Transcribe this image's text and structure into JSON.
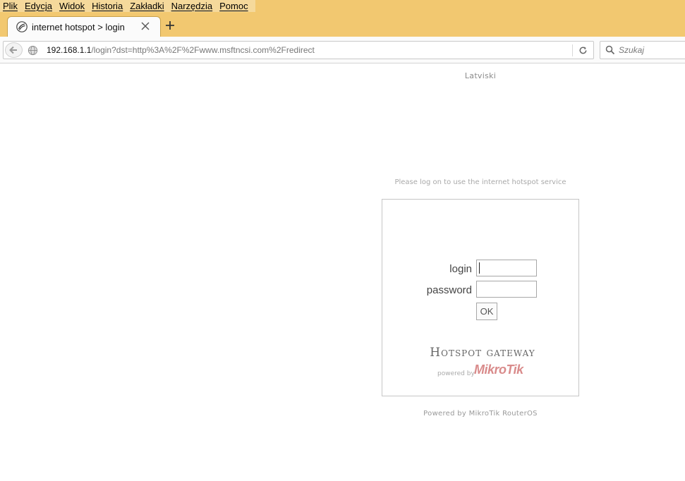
{
  "menubar": {
    "items": [
      "Plik",
      "Edycja",
      "Widok",
      "Historia",
      "Zakładki",
      "Narzędzia",
      "Pomoc"
    ]
  },
  "tab": {
    "title": "internet hotspot > login",
    "icon": "mikrotik-favicon-icon"
  },
  "urlbar": {
    "host": "192.168.1.1",
    "path": "/login?dst=http%3A%2F%2Fwww.msftncsi.com%2Fredirect"
  },
  "search": {
    "placeholder": "Szukaj"
  },
  "page": {
    "language_link": "Latviski",
    "notice": "Please log on to use the internet hotspot service",
    "login_label": "login",
    "password_label": "password",
    "login_value": "",
    "password_value": "",
    "ok_label": "OK",
    "hotspot_title": "Hotspot gateway",
    "powered_by_small": "powered by",
    "logo_text": "MikroTik",
    "footer": "Powered by MikroTik RouterOS"
  },
  "colors": {
    "chrome_accent": "#f2c870",
    "logo": "#d98b8b"
  }
}
